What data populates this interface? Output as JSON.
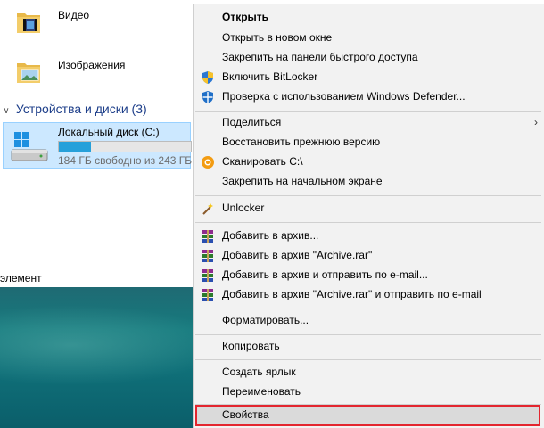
{
  "explorer": {
    "folders": [
      {
        "name": "Видео",
        "icon": "video-folder-icon"
      },
      {
        "name": "Изображения",
        "icon": "pictures-folder-icon"
      }
    ],
    "section_title": "Устройства и диски (3)",
    "drive": {
      "name": "Локальный диск (C:)",
      "free_text": "184 ГБ свободно из 243 ГБ",
      "used_fraction": 0.24
    },
    "status_text": "элемент"
  },
  "context_menu": {
    "open": "Открыть",
    "open_new_window": "Открыть в новом окне",
    "pin_quick_access": "Закрепить на панели быстрого доступа",
    "bitlocker": "Включить BitLocker",
    "defender": "Проверка с использованием Windows Defender...",
    "share": "Поделиться",
    "restore": "Восстановить прежнюю версию",
    "scan": "Сканировать C:\\",
    "pin_start": "Закрепить на начальном экране",
    "unlocker": "Unlocker",
    "add_archive": "Добавить в архив...",
    "add_archive_rar": "Добавить в архив \"Archive.rar\"",
    "add_archive_email": "Добавить в архив и отправить по e-mail...",
    "add_archive_rar_email": "Добавить в архив \"Archive.rar\" и отправить по e-mail",
    "format": "Форматировать...",
    "copy": "Копировать",
    "create_shortcut": "Создать ярлык",
    "rename": "Переименовать",
    "properties": "Свойства"
  },
  "colors": {
    "selection_bg": "#cce8ff",
    "highlight_border": "#e3262f",
    "progress_fill": "#26a0da",
    "menu_bg": "#f2f2f2"
  }
}
